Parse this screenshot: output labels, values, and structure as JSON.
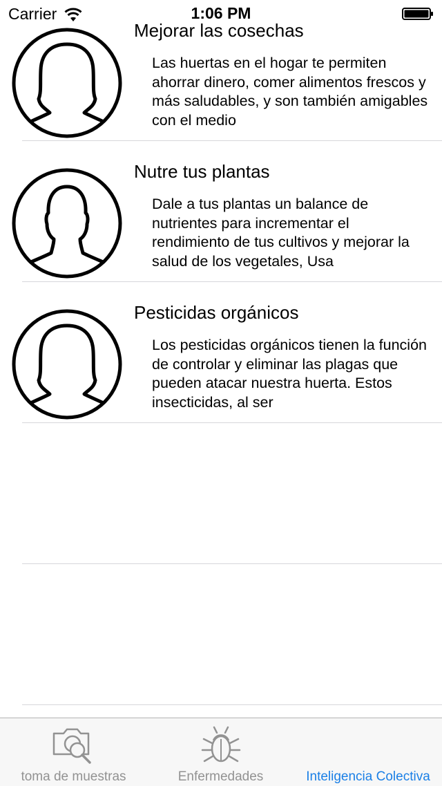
{
  "status_bar": {
    "carrier": "Carrier",
    "time": "1:06 PM",
    "wifi_icon": "wifi-icon",
    "battery_icon": "battery-icon"
  },
  "feed": {
    "items": [
      {
        "title": "Mejorar las cosechas",
        "body": "Las huertas en el hogar te permiten ahorrar dinero, comer alimentos frescos y más saludables, y son también amigables con el medio",
        "avatar_icon": "female-avatar-icon"
      },
      {
        "title": "Nutre tus plantas",
        "body": "Dale a tus plantas un balance de nutrientes para incrementar el rendimiento de tus cultivos y mejorar la salud de los vegetales, Usa",
        "avatar_icon": "male-avatar-icon"
      },
      {
        "title": "Pesticidas orgánicos",
        "body": "Los pesticidas orgánicos tienen la función de controlar y eliminar las plagas que pueden atacar nuestra huerta. Estos insecticidas, al ser",
        "avatar_icon": "female-avatar-icon"
      }
    ]
  },
  "tab_bar": {
    "tabs": [
      {
        "label": "toma de muestras",
        "icon": "camera-search-icon",
        "active": false
      },
      {
        "label": "Enfermedades",
        "icon": "bug-icon",
        "active": false
      },
      {
        "label": "Inteligencia Colectiva",
        "icon": "",
        "active": true
      }
    ],
    "active_color": "#1a7fe6",
    "inactive_color": "#929292"
  }
}
